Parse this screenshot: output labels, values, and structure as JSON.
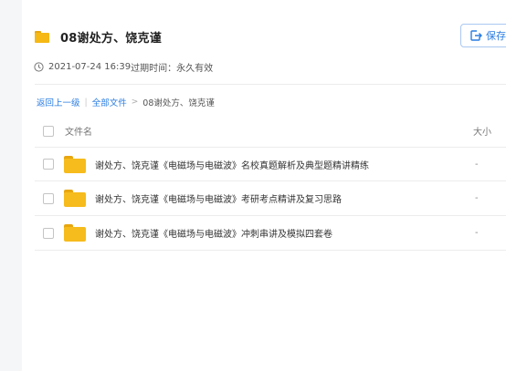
{
  "header": {
    "title": "08谢处方、饶克谨",
    "save_label": "保存到"
  },
  "meta": {
    "timestamp": "2021-07-24 16:39",
    "expire_label": "过期时间：",
    "expire_value": "永久有效"
  },
  "breadcrumb": {
    "back": "返回上一级",
    "all": "全部文件",
    "current": "08谢处方、饶克谨"
  },
  "table": {
    "col_name": "文件名",
    "col_size": "大小",
    "rows": [
      {
        "name": "谢处方、饶克谨《电磁场与电磁波》名校真题解析及典型题精讲精练",
        "size": "-"
      },
      {
        "name": "谢处方、饶克谨《电磁场与电磁波》考研考点精讲及复习思路",
        "size": "-"
      },
      {
        "name": "谢处方、饶克谨《电磁场与电磁波》冲刺串讲及模拟四套卷",
        "size": "-"
      }
    ]
  },
  "colors": {
    "accent": "#2a7de1",
    "folder": "#f6bb1c"
  }
}
